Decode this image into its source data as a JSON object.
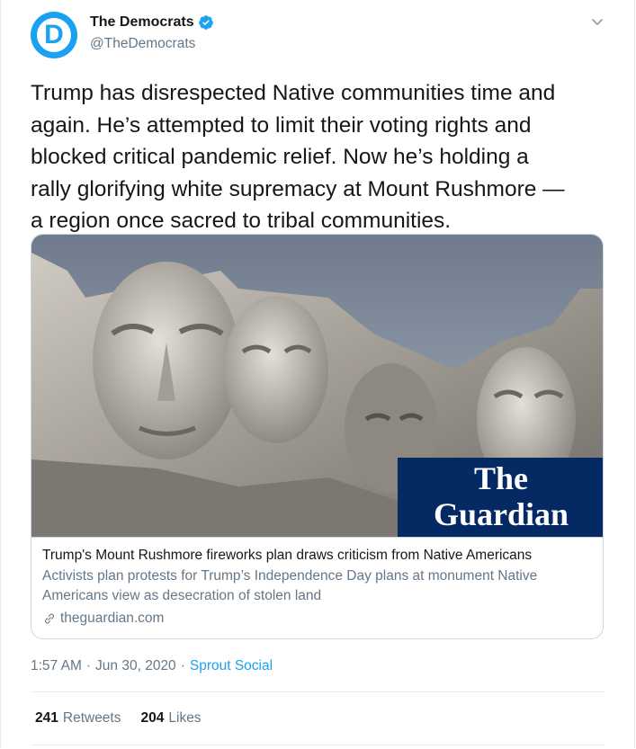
{
  "account": {
    "name": "The Democrats",
    "handle": "@TheDemocrats",
    "avatar_letter": "D",
    "verified": true
  },
  "tweet": {
    "text": "Trump has disrespected Native communities time and\nagain. He’s attempted to limit their voting rights and\nblocked critical pandemic relief. Now he’s holding a\nrally glorifying white supremacy at Mount Rushmore —\na region once sacred to tribal communities."
  },
  "card": {
    "image_logo_line1": "The",
    "image_logo_line2": "Guardian",
    "title": "Trump's Mount Rushmore fireworks plan draws criticism from Native Americans",
    "description": "Activists plan protests for Trump’s Independence Day plans at monument Native Americans view as desecration of stolen land",
    "domain": "theguardian.com"
  },
  "meta": {
    "time": "1:57 AM",
    "separator": "·",
    "date": "Jun 30, 2020",
    "source": "Sprout Social"
  },
  "stats": {
    "retweets_count": "241",
    "retweets_label": "Retweets",
    "likes_count": "204",
    "likes_label": "Likes"
  },
  "colors": {
    "brand_blue": "#1aa1f2",
    "guardian_blue": "#052962",
    "link_blue": "#1da1f2",
    "secondary_text": "#657786"
  },
  "icons": {
    "verified": "verified-badge-icon",
    "caret": "chevron-down-icon",
    "link": "link-icon"
  }
}
